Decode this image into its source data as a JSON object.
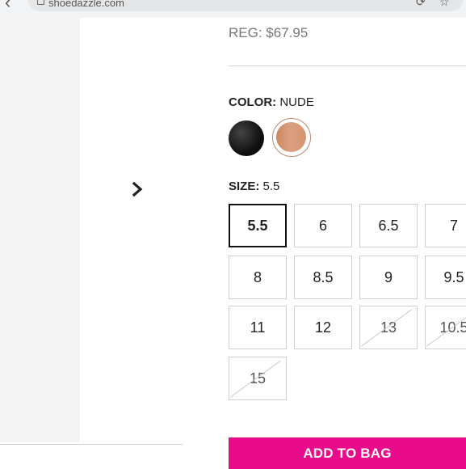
{
  "browser": {
    "url": "shoedazzle.com"
  },
  "product": {
    "reg_price": "REG: $67.95",
    "color_label": "COLOR:",
    "color_value": "NUDE",
    "swatches": [
      {
        "name": "black",
        "selected": false
      },
      {
        "name": "nude",
        "selected": true
      }
    ],
    "size_label": "SIZE:",
    "size_value": "5.5",
    "sizes": [
      "5.5",
      "6",
      "6.5",
      "7",
      "8",
      "8.5",
      "9",
      "9.5",
      "11",
      "12",
      "13",
      "10.5",
      "15"
    ],
    "sold_out_sizes": [
      "13",
      "10.5",
      "15"
    ],
    "selected_size": "5.5",
    "add_to_bag": "ADD TO BAG"
  },
  "colors": {
    "accent": "#ea0a8c"
  }
}
